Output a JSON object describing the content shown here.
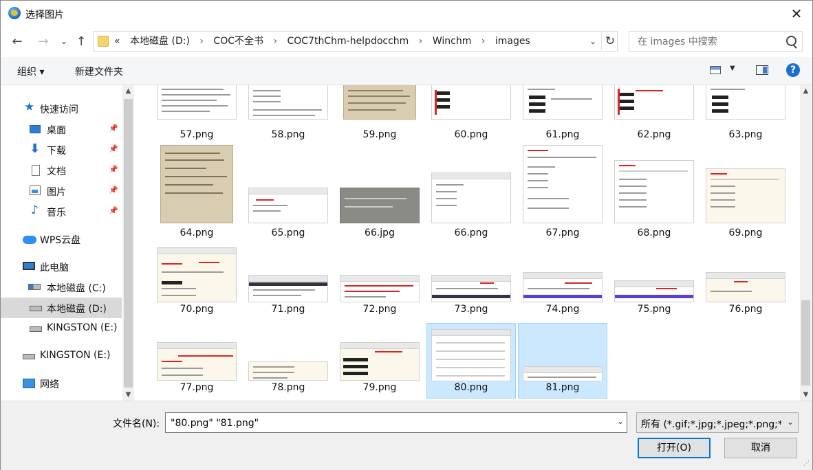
{
  "window": {
    "title": "选择图片",
    "close_symbol": "✕"
  },
  "nav": {
    "back_symbol": "←",
    "forward_symbol": "→",
    "recent_symbol": "⌄",
    "up_symbol": "↑"
  },
  "address": {
    "overflow": "«",
    "crumbs": [
      "本地磁盘 (D:)",
      "COC不全书",
      "COC7thChm-helpdocchm",
      "Winchm",
      "images"
    ],
    "separator": "›",
    "refresh_symbol": "↻",
    "dropdown_symbol": "⌄"
  },
  "search": {
    "placeholder": "在 images 中搜索"
  },
  "toolbar": {
    "organize_label": "组织 ▾",
    "new_folder_label": "新建文件夹",
    "help_label": "?"
  },
  "sidebar": {
    "items": [
      {
        "label": "快速访问",
        "icon": "star-icon"
      },
      {
        "label": "桌面",
        "icon": "desktop-icon",
        "pinned": true
      },
      {
        "label": "下载",
        "icon": "download-icon",
        "pinned": true
      },
      {
        "label": "文档",
        "icon": "document-icon",
        "pinned": true
      },
      {
        "label": "图片",
        "icon": "pictures-icon",
        "pinned": true
      },
      {
        "label": "音乐",
        "icon": "music-icon",
        "pinned": true
      },
      {
        "label": "WPS云盘",
        "icon": "cloud-icon"
      },
      {
        "label": "此电脑",
        "icon": "computer-icon"
      },
      {
        "label": "本地磁盘 (C:)",
        "icon": "drive-c-icon"
      },
      {
        "label": "本地磁盘 (D:)",
        "icon": "drive-icon",
        "selected": true
      },
      {
        "label": "KINGSTON (E:)",
        "icon": "usb-drive-icon"
      },
      {
        "label": "KINGSTON (E:)",
        "icon": "usb-drive-icon"
      },
      {
        "label": "网络",
        "icon": "network-icon"
      }
    ]
  },
  "files": [
    "57.png",
    "58.png",
    "59.png",
    "60.png",
    "61.png",
    "62.png",
    "63.png",
    "64.png",
    "65.png",
    "66.jpg",
    "66.png",
    "67.png",
    "68.png",
    "69.png",
    "70.png",
    "71.png",
    "72.png",
    "73.png",
    "74.png",
    "75.png",
    "76.png",
    "77.png",
    "78.png",
    "79.png",
    "80.png",
    "81.png"
  ],
  "selected_files": [
    "80.png",
    "81.png"
  ],
  "bottom": {
    "filename_label": "文件名(N):",
    "filename_value": "\"80.png\" \"81.png\"",
    "filetype_value": "所有 (*.gif;*.jpg;*.jpeg;*.png;*",
    "open_label": "打开(O)",
    "cancel_label": "取消"
  },
  "colors": {
    "accent": "#0078d7",
    "selection": "#cce8ff",
    "selection_border": "#99d1ff"
  }
}
